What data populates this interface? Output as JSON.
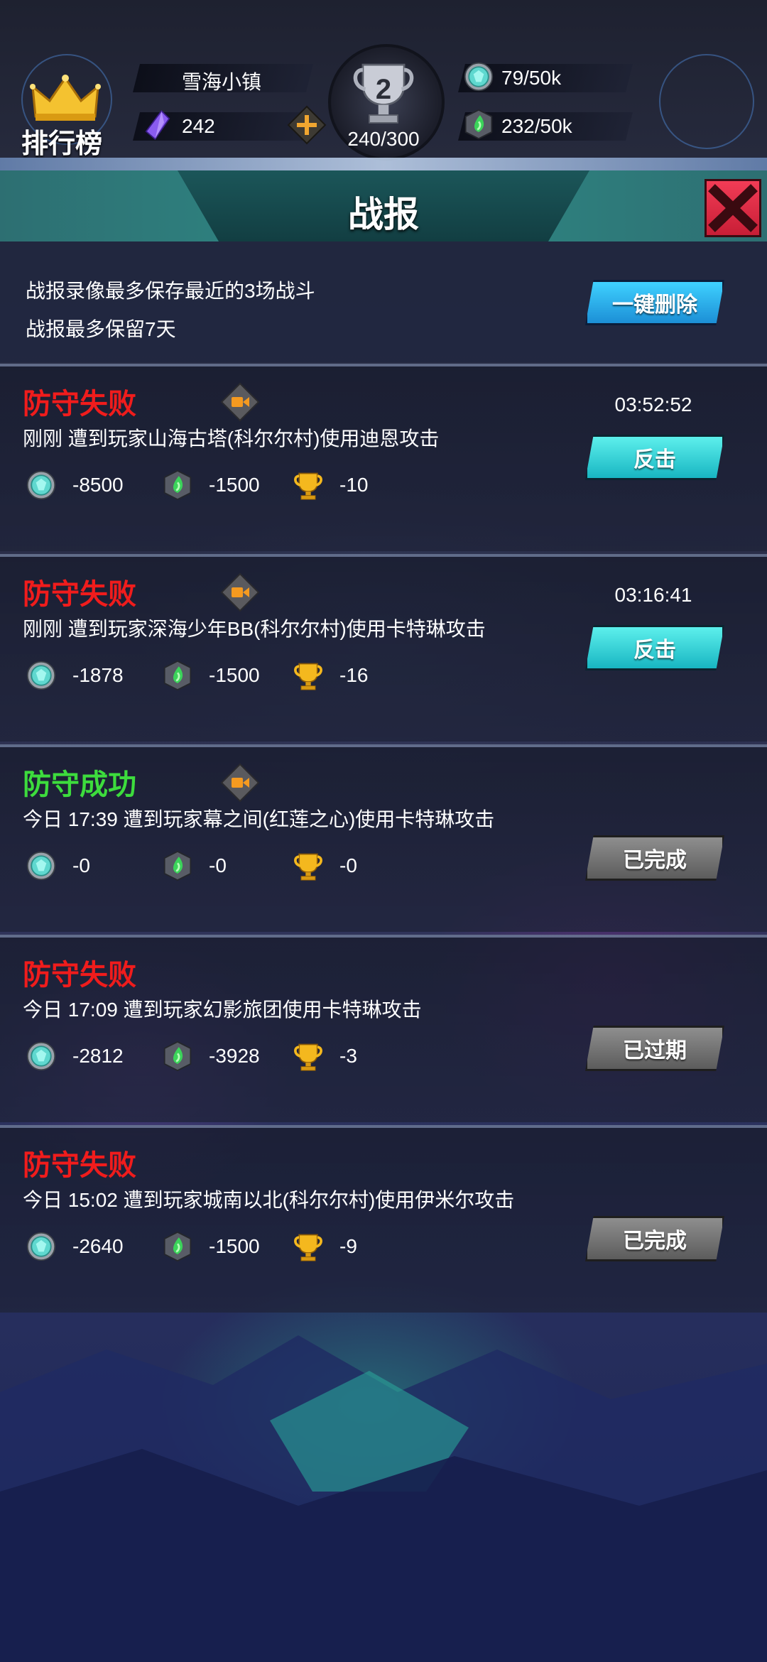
{
  "header": {
    "ranking_label": "排行榜",
    "town_name": "雪海小镇",
    "gems": "242",
    "trophy_level": "2",
    "trophy_progress": "240/300",
    "coins": "79/50k",
    "elixir": "232/50k"
  },
  "panel": {
    "title": "战报",
    "info_line1": "战报录像最多保存最近的3场战斗",
    "info_line2": "战报最多保留7天",
    "delete_all_label": "一键删除"
  },
  "reports": [
    {
      "status": "防守失败",
      "result": "fail",
      "has_video": true,
      "desc": "刚刚 遭到玩家山海古塔(科尔尔村)使用迪恩攻击",
      "coins": "-8500",
      "elixir": "-1500",
      "trophies": "-10",
      "timer": "03:52:52",
      "action": "反击",
      "action_style": "cyan"
    },
    {
      "status": "防守失败",
      "result": "fail",
      "has_video": true,
      "desc": "刚刚 遭到玩家深海少年BB(科尔尔村)使用卡特琳攻击",
      "coins": "-1878",
      "elixir": "-1500",
      "trophies": "-16",
      "timer": "03:16:41",
      "action": "反击",
      "action_style": "cyan"
    },
    {
      "status": "防守成功",
      "result": "success",
      "has_video": true,
      "desc": "今日 17:39 遭到玩家幕之间(红莲之心)使用卡特琳攻击",
      "coins": "-0",
      "elixir": "-0",
      "trophies": "-0",
      "timer": "",
      "action": "已完成",
      "action_style": "gray"
    },
    {
      "status": "防守失败",
      "result": "fail",
      "has_video": false,
      "desc": "今日 17:09 遭到玩家幻影旅团使用卡特琳攻击",
      "coins": "-2812",
      "elixir": "-3928",
      "trophies": "-3",
      "timer": "",
      "action": "已过期",
      "action_style": "gray"
    },
    {
      "status": "防守失败",
      "result": "fail",
      "has_video": false,
      "desc": "今日 15:02 遭到玩家城南以北(科尔尔村)使用伊米尔攻击",
      "coins": "-2640",
      "elixir": "-1500",
      "trophies": "-9",
      "timer": "",
      "action": "已完成",
      "action_style": "gray"
    }
  ],
  "colors": {
    "fail": "#f01c1c",
    "success": "#3ddc3d",
    "accent": "#2f8b86"
  },
  "icons": [
    "crown-icon",
    "gem-icon",
    "plus-icon",
    "trophy-icon",
    "coin-icon",
    "elixir-icon",
    "video-icon",
    "close-icon"
  ]
}
